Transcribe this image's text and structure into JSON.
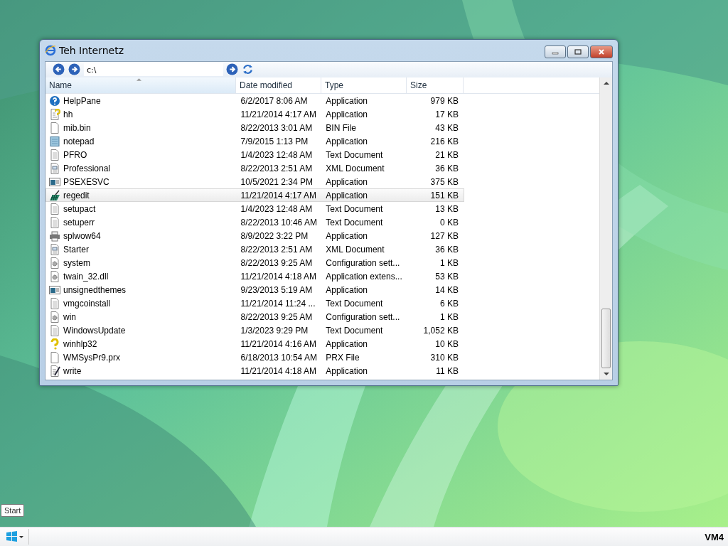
{
  "window": {
    "title": "Teh Internetz"
  },
  "toolbar": {
    "address": "c:\\"
  },
  "columns": [
    {
      "label": "Name",
      "sorted": true
    },
    {
      "label": "Date modified",
      "sorted": false
    },
    {
      "label": "Type",
      "sorted": false
    },
    {
      "label": "Size",
      "sorted": false
    }
  ],
  "rows": [
    {
      "kind": "help",
      "name": "HelpPane",
      "date": "6/2/2017 8:06 AM",
      "type": "Application",
      "size": "979 KB",
      "selected": false
    },
    {
      "kind": "helpfile",
      "name": "hh",
      "date": "11/21/2014 4:17 AM",
      "type": "Application",
      "size": "17 KB",
      "selected": false
    },
    {
      "kind": "file",
      "name": "mib.bin",
      "date": "8/22/2013 3:01 AM",
      "type": "BIN File",
      "size": "43 KB",
      "selected": false
    },
    {
      "kind": "notepad",
      "name": "notepad",
      "date": "7/9/2015 1:13 PM",
      "type": "Application",
      "size": "216 KB",
      "selected": false
    },
    {
      "kind": "text",
      "name": "PFRO",
      "date": "1/4/2023 12:48 AM",
      "type": "Text Document",
      "size": "21 KB",
      "selected": false
    },
    {
      "kind": "xml",
      "name": "Professional",
      "date": "8/22/2013 2:51 AM",
      "type": "XML Document",
      "size": "36 KB",
      "selected": false
    },
    {
      "kind": "window",
      "name": "PSEXESVC",
      "date": "10/5/2021 2:34 PM",
      "type": "Application",
      "size": "375 KB",
      "selected": false
    },
    {
      "kind": "registry",
      "name": "regedit",
      "date": "11/21/2014 4:17 AM",
      "type": "Application",
      "size": "151 KB",
      "selected": true
    },
    {
      "kind": "text",
      "name": "setupact",
      "date": "1/4/2023 12:48 AM",
      "type": "Text Document",
      "size": "13 KB",
      "selected": false
    },
    {
      "kind": "text",
      "name": "setuperr",
      "date": "8/22/2013 10:46 AM",
      "type": "Text Document",
      "size": "0 KB",
      "selected": false
    },
    {
      "kind": "printer",
      "name": "splwow64",
      "date": "8/9/2022 3:22 PM",
      "type": "Application",
      "size": "127 KB",
      "selected": false
    },
    {
      "kind": "xml",
      "name": "Starter",
      "date": "8/22/2013 2:51 AM",
      "type": "XML Document",
      "size": "36 KB",
      "selected": false
    },
    {
      "kind": "settings",
      "name": "system",
      "date": "8/22/2013 9:25 AM",
      "type": "Configuration sett...",
      "size": "1 KB",
      "selected": false
    },
    {
      "kind": "dll",
      "name": "twain_32.dll",
      "date": "11/21/2014 4:18 AM",
      "type": "Application extens...",
      "size": "53 KB",
      "selected": false
    },
    {
      "kind": "window",
      "name": "unsignedthemes",
      "date": "9/23/2013 5:19 AM",
      "type": "Application",
      "size": "14 KB",
      "selected": false
    },
    {
      "kind": "text",
      "name": "vmgcoinstall",
      "date": "11/21/2014 11:24 ...",
      "type": "Text Document",
      "size": "6 KB",
      "selected": false
    },
    {
      "kind": "settings",
      "name": "win",
      "date": "8/22/2013 9:25 AM",
      "type": "Configuration sett...",
      "size": "1 KB",
      "selected": false
    },
    {
      "kind": "text",
      "name": "WindowsUpdate",
      "date": "1/3/2023 9:29 PM",
      "type": "Text Document",
      "size": "1,052 KB",
      "selected": false
    },
    {
      "kind": "question",
      "name": "winhlp32",
      "date": "11/21/2014 4:16 AM",
      "type": "Application",
      "size": "10 KB",
      "selected": false
    },
    {
      "kind": "file",
      "name": "WMSysPr9.prx",
      "date": "6/18/2013 10:54 AM",
      "type": "PRX File",
      "size": "310 KB",
      "selected": false
    },
    {
      "kind": "write",
      "name": "write",
      "date": "11/21/2014 4:18 AM",
      "type": "Application",
      "size": "11 KB",
      "selected": false
    }
  ],
  "tooltip": "Start",
  "taskbar": {
    "label": "VM4"
  }
}
